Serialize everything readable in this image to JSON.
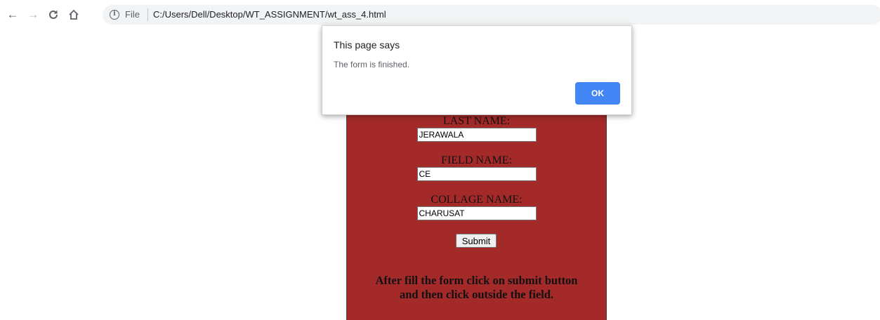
{
  "browser": {
    "back_icon": "arrow-left-icon",
    "forward_icon": "arrow-right-icon",
    "reload_icon": "reload-icon",
    "home_icon": "home-icon",
    "scheme_label": "File",
    "url": "C:/Users/Dell/Desktop/WT_ASSIGNMENT/wt_ass_4.html"
  },
  "form": {
    "background_color": "#a42a2a",
    "fields": [
      {
        "label": "LAST NAME:",
        "value": "JERAWALA"
      },
      {
        "label": "FIELD NAME:",
        "value": "CE"
      },
      {
        "label": "COLLAGE NAME:",
        "value": "CHARUSAT"
      }
    ],
    "submit_label": "Submit",
    "instructions_line1": "After fill the form click on submit button",
    "instructions_line2": "and then click outside the field."
  },
  "dialog": {
    "title": "This page says",
    "message": "The form is finished.",
    "ok_label": "OK",
    "ok_color": "#4285f4"
  }
}
